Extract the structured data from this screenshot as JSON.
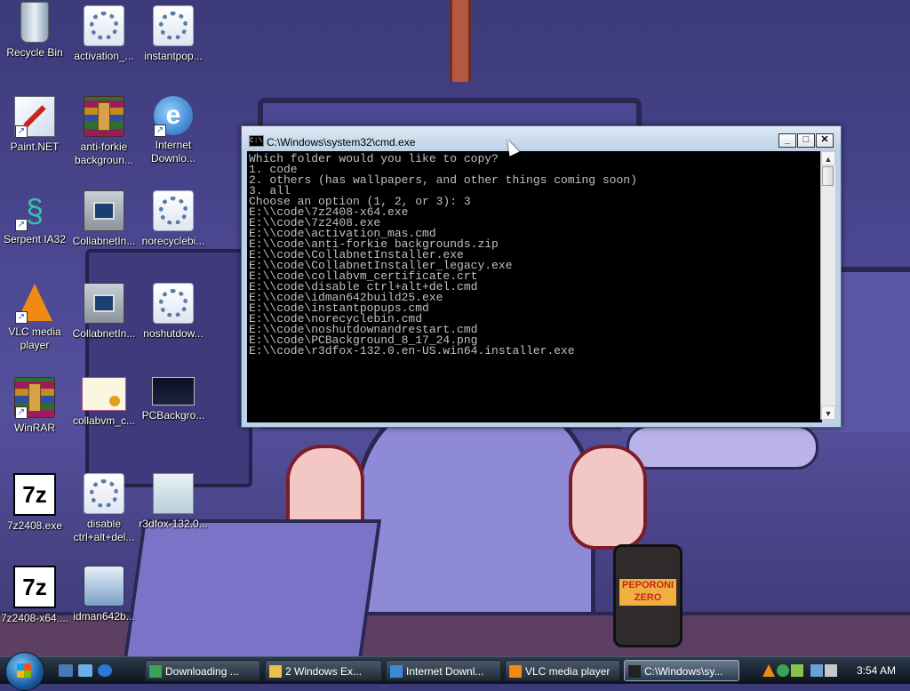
{
  "desktop_icons": [
    {
      "label": "Recycle Bin"
    },
    {
      "label": "activation_..."
    },
    {
      "label": "instantpop..."
    },
    {
      "label": "Paint.NET"
    },
    {
      "label": "anti-forkie backgroun..."
    },
    {
      "label": "Internet Downlo..."
    },
    {
      "label": "Serpent IA32"
    },
    {
      "label": "CollabnetIn..."
    },
    {
      "label": "norecyclebi..."
    },
    {
      "label": "VLC media player"
    },
    {
      "label": "CollabnetIn..."
    },
    {
      "label": "noshutdow..."
    },
    {
      "label": "WinRAR"
    },
    {
      "label": "collabvm_c..."
    },
    {
      "label": "PCBackgro..."
    },
    {
      "label": "7z2408.exe"
    },
    {
      "label": "disable ctrl+alt+del..."
    },
    {
      "label": "r3dfox-132.0..."
    },
    {
      "label": "7z2408-x64...."
    },
    {
      "label": "idman642b..."
    }
  ],
  "seven_zip_glyph": "7z",
  "cmd_window": {
    "title": "C:\\Windows\\system32\\cmd.exe",
    "minimize": "_",
    "maximize": "□",
    "close": "✕",
    "lines": [
      "Which folder would you like to copy?",
      "1. code",
      "2. others (has wallpapers, and other things coming soon)",
      "3. all",
      "Choose an option (1, 2, or 3): 3",
      "E:\\\\code\\7z2408-x64.exe",
      "E:\\\\code\\7z2408.exe",
      "E:\\\\code\\activation_mas.cmd",
      "E:\\\\code\\anti-forkie backgrounds.zip",
      "E:\\\\code\\CollabnetInstaller.exe",
      "E:\\\\code\\CollabnetInstaller_legacy.exe",
      "E:\\\\code\\collabvm_certificate.crt",
      "E:\\\\code\\disable ctrl+alt+del.cmd",
      "E:\\\\code\\idman642build25.exe",
      "E:\\\\code\\instantpopups.cmd",
      "E:\\\\code\\norecyclebin.cmd",
      "E:\\\\code\\noshutdownandrestart.cmd",
      "E:\\\\code\\PCBackground_8_17_24.png",
      "E:\\\\code\\r3dfox-132.0.en-US.win64.installer.exe"
    ]
  },
  "wallpaper": {
    "can_label": "PEPORONI ZERO"
  },
  "taskbar": {
    "tasks": [
      {
        "label": "Downloading ...",
        "icon_color": "#3aa35a"
      },
      {
        "label": "2 Windows Ex...",
        "icon_color": "#e8c04a"
      },
      {
        "label": "Internet Downl...",
        "icon_color": "#3a8ad6"
      },
      {
        "label": "VLC media player",
        "icon_color": "#f08a13"
      },
      {
        "label": "C:\\Windows\\sy...",
        "icon_color": "#222222"
      }
    ],
    "clock": "3:54 AM"
  },
  "colors": {
    "console_bg": "#000000",
    "console_fg": "#c0c0c0",
    "taskbar_bg": "#1a2430"
  }
}
